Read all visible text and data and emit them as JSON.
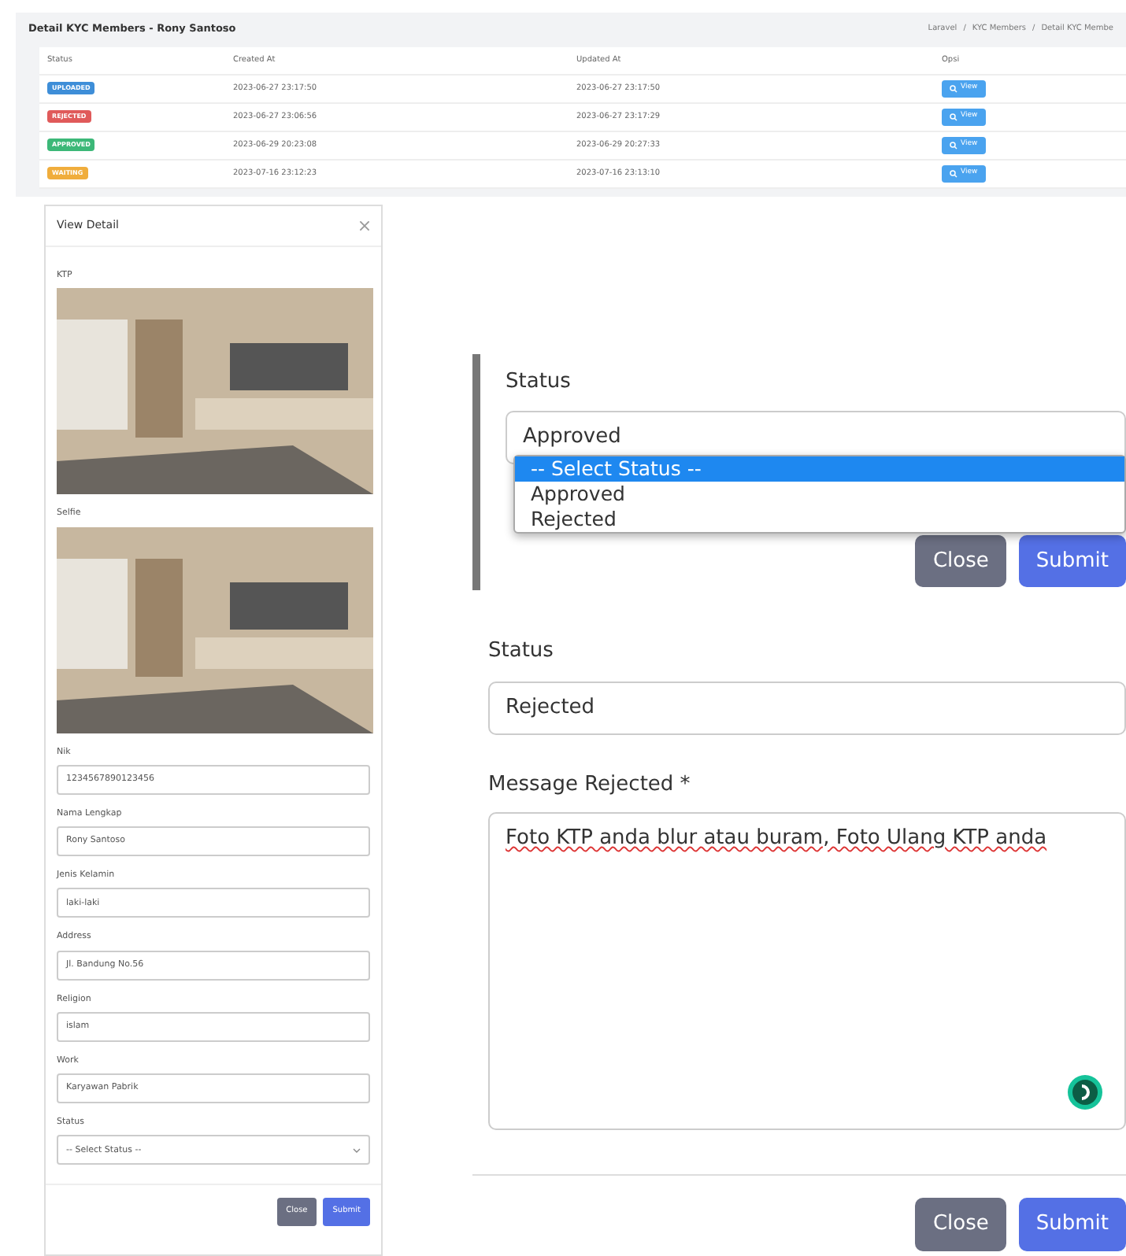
{
  "header": {
    "title": "Detail KYC Members - Rony Santoso",
    "breadcrumb": [
      "Laravel",
      "KYC Members",
      "Detail KYC Membe"
    ],
    "separator": "/"
  },
  "table": {
    "columns": [
      "Status",
      "Created At",
      "Updated At",
      "Opsi"
    ],
    "rows": [
      {
        "status": "UPLOADED",
        "color": "#3e8ed8",
        "created_at": "2023-06-27 23:17:50",
        "updated_at": "2023-06-27 23:17:50",
        "action": "View"
      },
      {
        "status": "REJECTED",
        "color": "#e05a5a",
        "created_at": "2023-06-27 23:06:56",
        "updated_at": "2023-06-27 23:17:29",
        "action": "View"
      },
      {
        "status": "APPROVED",
        "color": "#3cb878",
        "created_at": "2023-06-29 20:23:08",
        "updated_at": "2023-06-29 20:27:33",
        "action": "View"
      },
      {
        "status": "WAITING",
        "color": "#f0ad3c",
        "created_at": "2023-07-16 23:12:23",
        "updated_at": "2023-07-16 23:13:10",
        "action": "View"
      }
    ]
  },
  "modal": {
    "title": "View Detail",
    "photos": [
      {
        "label": "KTP"
      },
      {
        "label": "Selfie"
      }
    ],
    "fields": [
      {
        "label": "Nik",
        "value": "1234567890123456",
        "kind": "input"
      },
      {
        "label": "Nama Lengkap",
        "value": "Rony Santoso",
        "kind": "input"
      },
      {
        "label": "Jenis Kelamin",
        "value": "laki-laki",
        "kind": "input"
      },
      {
        "label": "Address",
        "value": "Jl. Bandung No.56",
        "kind": "input"
      },
      {
        "label": "Religion",
        "value": "islam",
        "kind": "input"
      },
      {
        "label": "Work",
        "value": "Karyawan Pabrik",
        "kind": "input"
      },
      {
        "label": "Status",
        "value": "-- Select Status --",
        "kind": "select"
      }
    ],
    "buttons": [
      {
        "label": "Close",
        "kind": "secondary"
      },
      {
        "label": "Submit",
        "kind": "primary"
      }
    ]
  },
  "status_dropdown": {
    "label": "Status",
    "value": "Approved",
    "options": [
      {
        "label": "-- Select Status --",
        "highlighted": true
      },
      {
        "label": "Approved",
        "highlighted": false
      },
      {
        "label": "Rejected",
        "highlighted": false
      }
    ],
    "buttons": [
      {
        "label": "Close",
        "kind": "secondary"
      },
      {
        "label": "Submit",
        "kind": "primary"
      }
    ]
  },
  "reject_form": {
    "status_label": "Status",
    "status_value": "Rejected",
    "message_label": "Message Rejected *",
    "message": "Foto KTP anda blur atau buram, Foto Ulang KTP anda",
    "buttons": [
      {
        "label": "Close",
        "kind": "secondary"
      },
      {
        "label": "Submit",
        "kind": "primary"
      }
    ]
  }
}
